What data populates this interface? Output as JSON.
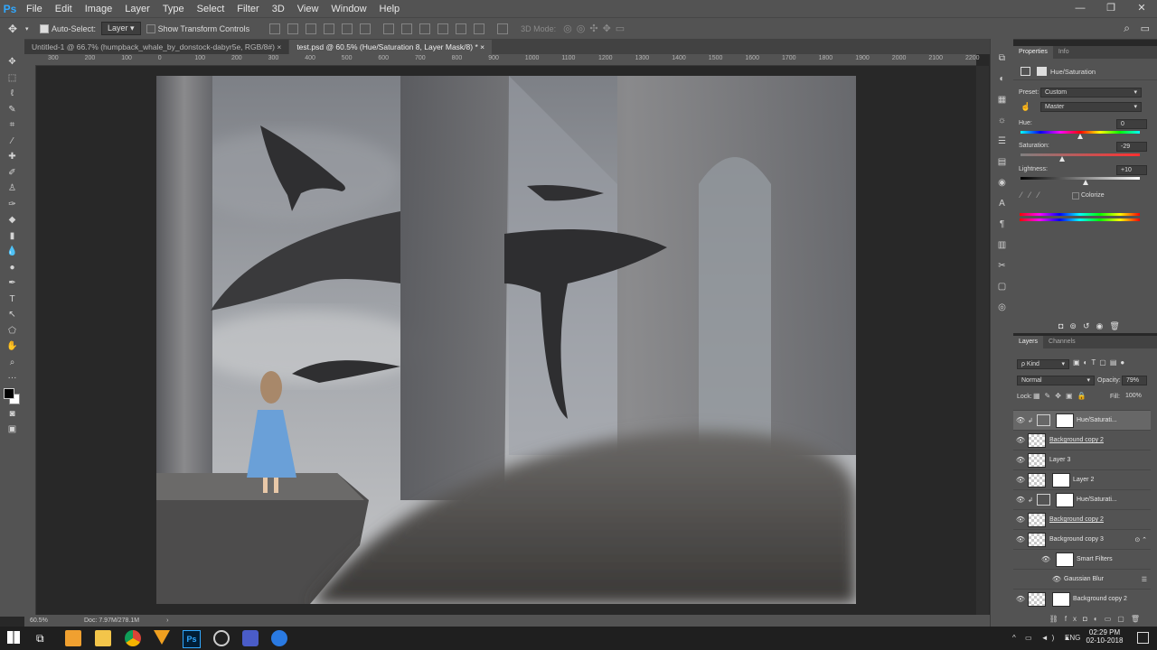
{
  "menubar": {
    "logo": "Ps",
    "items": [
      "File",
      "Edit",
      "Image",
      "Layer",
      "Type",
      "Select",
      "Filter",
      "3D",
      "View",
      "Window",
      "Help"
    ],
    "window_controls": [
      "—",
      "❐",
      "✕"
    ]
  },
  "options": {
    "auto_select_label": "Auto-Select:",
    "auto_select_target": "Layer",
    "transform_controls_label": "Show Transform Controls",
    "mode_3d": "3D Mode:"
  },
  "doc_tabs": [
    {
      "label": "Untitled-1 @ 66.7% (humpback_whale_by_donstock-dabyr5e, RGB/8#)",
      "close": "×"
    },
    {
      "label": "test.psd @ 60.5% (Hue/Saturation 8, Layer Mask/8) *",
      "close": "×"
    }
  ],
  "ruler": {
    "ticks": [
      "300",
      "200",
      "100",
      "0",
      "100",
      "200",
      "300",
      "400",
      "500",
      "600",
      "700",
      "800",
      "900",
      "1000",
      "1100",
      "1200",
      "1300",
      "1400",
      "1500",
      "1600",
      "1700",
      "1800",
      "1900",
      "2000",
      "2100",
      "2200"
    ]
  },
  "status": {
    "zoom": "60.5%",
    "doc": "Doc: 7.97M/278.1M",
    "arrow": "›"
  },
  "properties": {
    "tabs": [
      "Properties",
      "Info"
    ],
    "adjustment_title": "Hue/Saturation",
    "preset_label": "Preset:",
    "preset_value": "Custom",
    "channel_value": "Master",
    "hue_label": "Hue:",
    "hue_value": "0",
    "hue_pos": 0.5,
    "saturation_label": "Saturation:",
    "saturation_value": "-29",
    "saturation_pos": 0.355,
    "lightness_label": "Lightness:",
    "lightness_value": "+10",
    "lightness_pos": 0.55,
    "colorize_label": "Colorize"
  },
  "layers": {
    "tabs": [
      "Layers",
      "Channels"
    ],
    "kind_label": "ρ Kind",
    "blend_mode": "Normal",
    "opacity_label": "Opacity:",
    "opacity_value": "79%",
    "lock_label": "Lock:",
    "fill_label": "Fill:",
    "fill_value": "100%",
    "rows": [
      {
        "name": "Hue/Saturati...",
        "type": "adjustment",
        "selected": true
      },
      {
        "name": "Background copy 2",
        "type": "pixel",
        "selected": false
      },
      {
        "name": "Layer 3",
        "type": "pixel",
        "selected": false
      },
      {
        "name": "Layer 2",
        "type": "masked",
        "selected": false
      },
      {
        "name": "Hue/Saturati...",
        "type": "adjustment",
        "selected": false
      },
      {
        "name": "Background copy 2",
        "type": "pixel",
        "selected": false
      },
      {
        "name": "Background copy 3",
        "type": "smart",
        "selected": false
      },
      {
        "name": "Smart Filters",
        "type": "filtergroup",
        "selected": false
      },
      {
        "name": "Gaussian Blur",
        "type": "filter",
        "selected": false
      },
      {
        "name": "Background copy 2",
        "type": "masked",
        "selected": false
      }
    ]
  },
  "taskbar": {
    "time": "02:29 PM",
    "date": "02-10-2018",
    "lang": "ENG"
  },
  "colors": {
    "panel": "#535353",
    "dark": "#282828",
    "accent": "#31a8ff"
  }
}
